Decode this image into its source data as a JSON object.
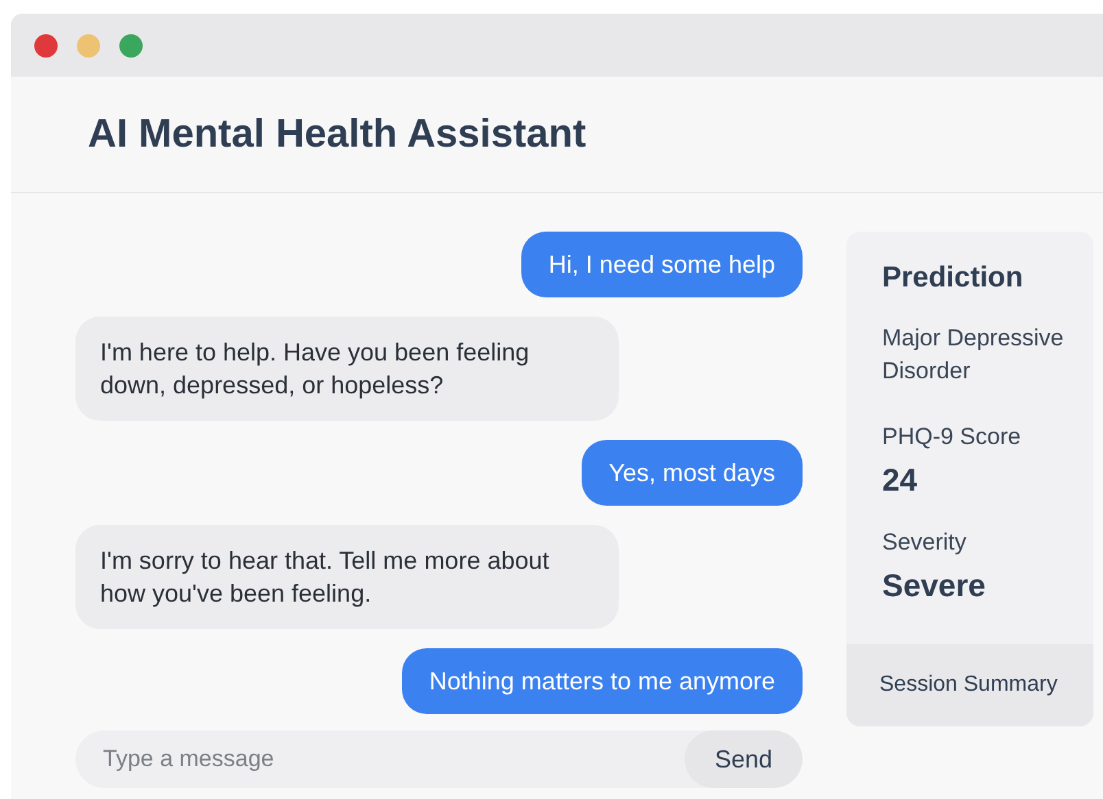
{
  "window": {
    "controls": [
      {
        "color": "#e0393b"
      },
      {
        "color": "#eec273"
      },
      {
        "color": "#3ba65e"
      }
    ]
  },
  "header": {
    "title": "AI Mental Health Assistant"
  },
  "messages": [
    {
      "kind": "user",
      "text": "Hi, I need some help"
    },
    {
      "kind": "assistant",
      "text": "I'm here to help. Have you been feeling down, depressed, or hopeless?"
    },
    {
      "kind": "user",
      "text": "Yes, most days"
    },
    {
      "kind": "assistant",
      "text": "I'm sorry to hear that. Tell me more about how you've been feeling."
    },
    {
      "kind": "user",
      "text": "Nothing matters to me anymore"
    }
  ],
  "composer": {
    "placeholder": "Type a message",
    "button": "Send"
  },
  "sidebar": {
    "title": "Prediction",
    "diagnosis": "Major Depressive Disorder",
    "score_label": "PHQ-9 Score",
    "score": "24",
    "severity_label": "Severity",
    "severity": "Severe",
    "footer": "Session Summary"
  }
}
